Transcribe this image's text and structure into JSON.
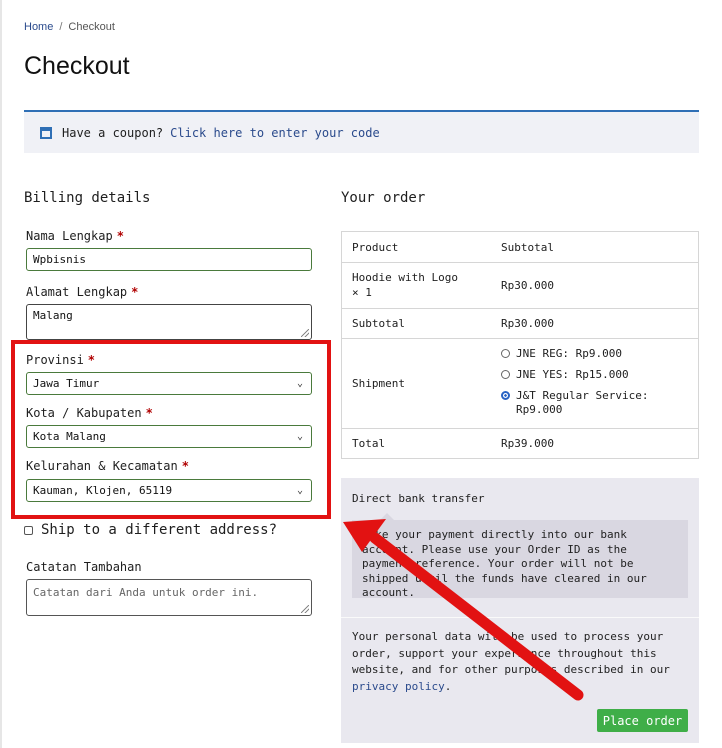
{
  "breadcrumb": {
    "home": "Home",
    "sep": "/",
    "current": "Checkout"
  },
  "page_title": "Checkout",
  "coupon": {
    "text": "Have a coupon?",
    "link": "Click here to enter your code"
  },
  "billing": {
    "heading": "Billing details",
    "nama_label": "Nama Lengkap",
    "nama_value": "Wpbisnis",
    "alamat_label": "Alamat Lengkap",
    "alamat_value": "Malang",
    "provinsi_label": "Provinsi",
    "provinsi_value": "Jawa Timur",
    "kota_label": "Kota / Kabupaten",
    "kota_value": "Kota Malang",
    "kel_label": "Kelurahan & Kecamatan",
    "kel_value": "Kauman, Klojen, 65119",
    "required": "*"
  },
  "ship_different": "Ship to a different address?",
  "notes": {
    "label": "Catatan Tambahan",
    "placeholder": "Catatan dari Anda untuk order ini."
  },
  "order": {
    "heading": "Your order",
    "col_product": "Product",
    "col_subtotal": "Subtotal",
    "item_name": "Hoodie with Logo",
    "item_qty": "× 1",
    "item_price": "Rp30.000",
    "subtotal_label": "Subtotal",
    "subtotal_value": "Rp30.000",
    "shipment_label": "Shipment",
    "shipping_options": [
      {
        "label": "JNE REG: Rp9.000",
        "selected": false
      },
      {
        "label": "JNE YES: Rp15.000",
        "selected": false
      },
      {
        "label": "J&T Regular Service: Rp9.000",
        "selected": true
      }
    ],
    "total_label": "Total",
    "total_value": "Rp39.000"
  },
  "payment": {
    "method": "Direct bank transfer",
    "description": "Make your payment directly into our bank account. Please use your Order ID as the payment reference. Your order will not be shipped until the funds have cleared in our account.",
    "privacy_text": "Your personal data will be used to process your order, support your experience throughout this website, and for other purposes described in our",
    "privacy_link": "privacy policy",
    "privacy_end": ".",
    "place_order": "Place order"
  },
  "colors": {
    "accent": "#2f6fb5",
    "highlight_box": "#e21212",
    "button": "#3fae48",
    "required": "#b00000"
  }
}
